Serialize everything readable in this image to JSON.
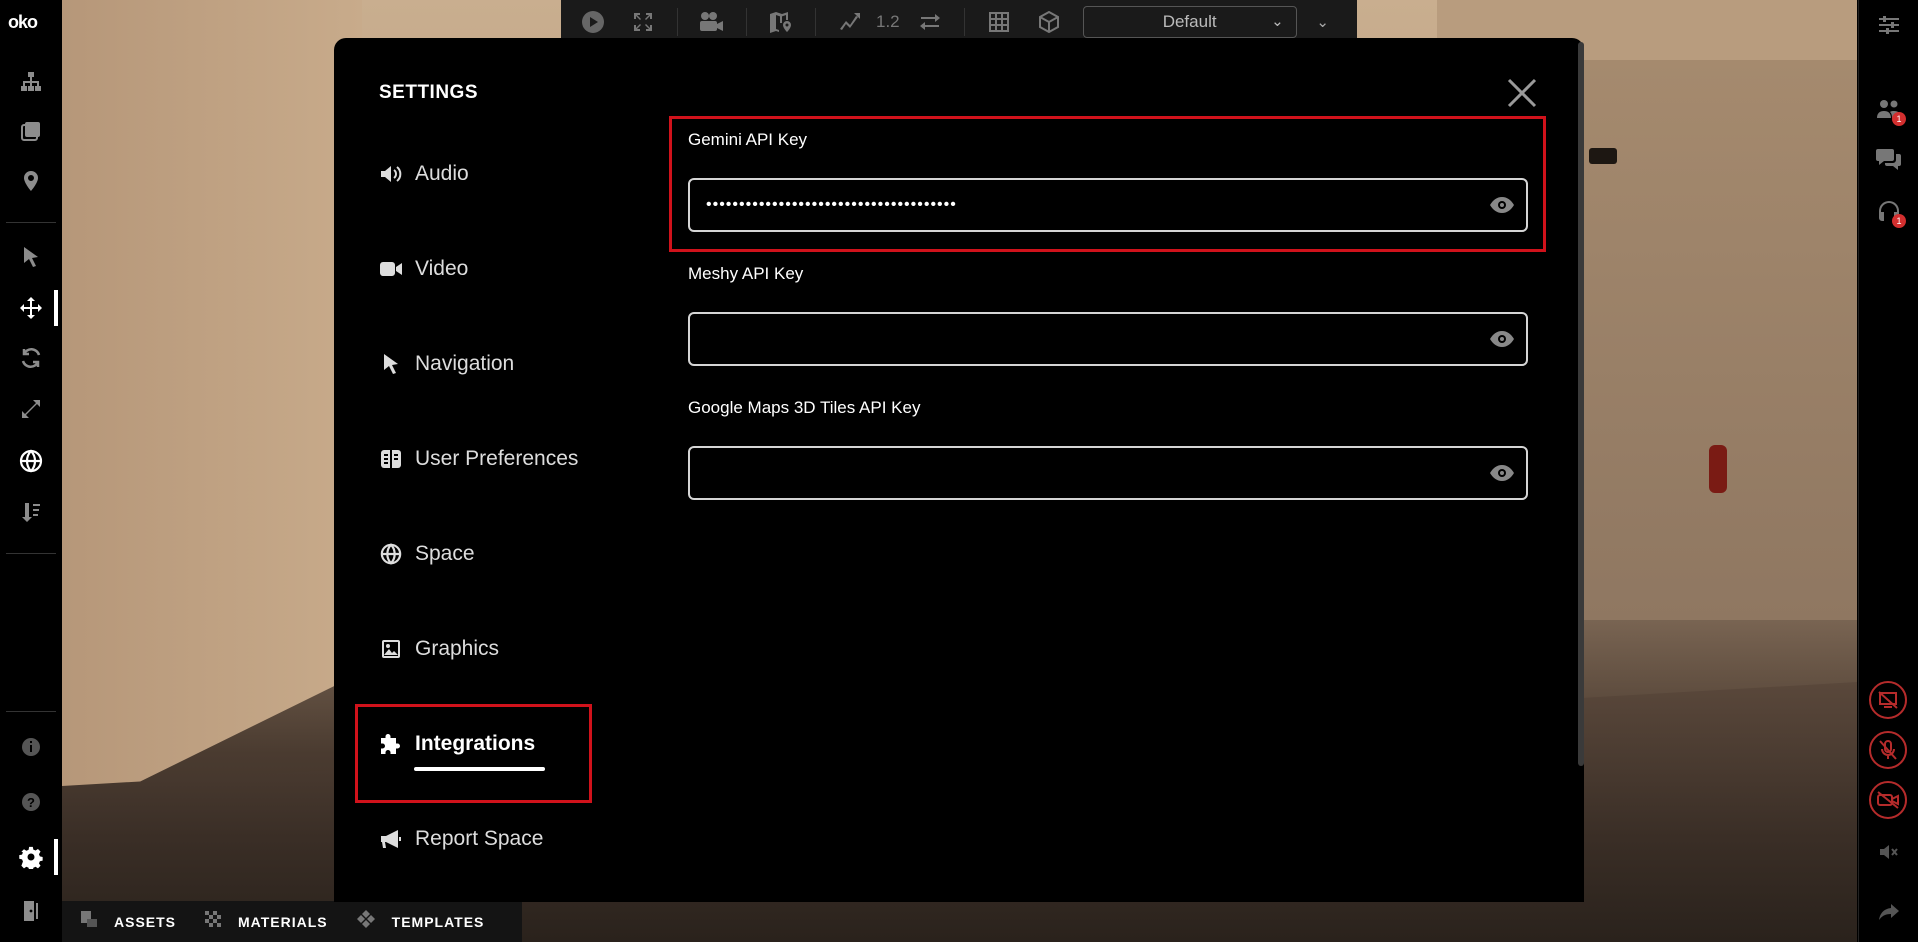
{
  "app": {
    "logo": "oko"
  },
  "top_toolbar": {
    "speed_value": "1.2",
    "view_select": "Default"
  },
  "bottom_tabs": [
    {
      "label": "ASSETS"
    },
    {
      "label": "MATERIALS"
    },
    {
      "label": "TEMPLATES"
    }
  ],
  "right_bar": {
    "people_badge": "1",
    "audio_badge": "1"
  },
  "settings": {
    "title": "SETTINGS",
    "nav": [
      {
        "label": "Audio",
        "icon": "speaker-icon"
      },
      {
        "label": "Video",
        "icon": "camera-icon"
      },
      {
        "label": "Navigation",
        "icon": "cursor-icon"
      },
      {
        "label": "User Preferences",
        "icon": "preferences-icon"
      },
      {
        "label": "Space",
        "icon": "globe-icon"
      },
      {
        "label": "Graphics",
        "icon": "image-icon"
      },
      {
        "label": "Integrations",
        "icon": "puzzle-icon"
      },
      {
        "label": "Report Space",
        "icon": "megaphone-icon"
      }
    ],
    "active_nav": "Integrations",
    "fields": [
      {
        "label": "Gemini API Key",
        "value": "••••••••••••••••••••••••••••••••••••••",
        "placeholder": ""
      },
      {
        "label": "Meshy API Key",
        "value": "",
        "placeholder": ""
      },
      {
        "label": "Google Maps 3D Tiles API Key",
        "value": "",
        "placeholder": ""
      }
    ]
  },
  "colors": {
    "highlight": "#d0121b",
    "modal_bg": "#000000",
    "accent": "#ffffff"
  }
}
